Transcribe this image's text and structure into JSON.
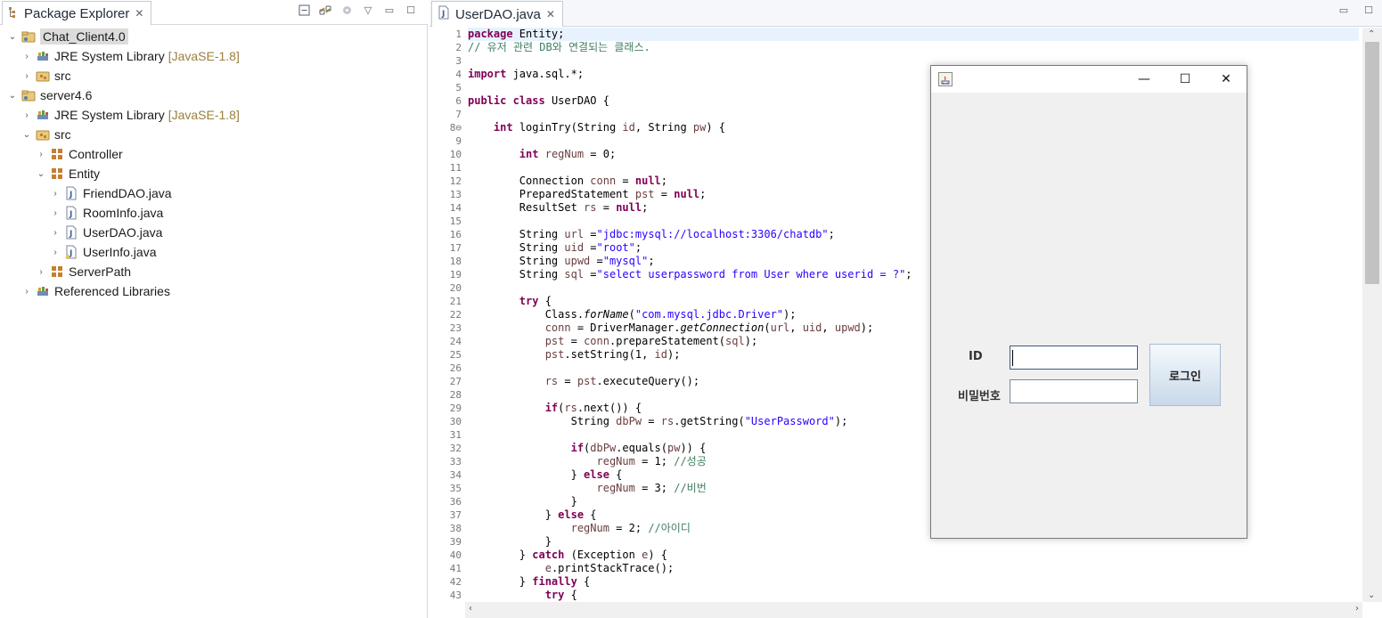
{
  "package_explorer": {
    "title": "Package Explorer",
    "tree": [
      {
        "label": "Chat_Client4.0",
        "decoration": "",
        "icon": "java-project-icon",
        "selected": true,
        "expanded": true
      },
      {
        "label": "JRE System Library",
        "decoration": "[JavaSE-1.8]",
        "icon": "library-icon",
        "expanded": false
      },
      {
        "label": "src",
        "decoration": "",
        "icon": "source-folder-icon",
        "expanded": false
      },
      {
        "label": "server4.6",
        "decoration": "",
        "icon": "java-project-icon",
        "expanded": true
      },
      {
        "label": "JRE System Library",
        "decoration": "[JavaSE-1.8]",
        "icon": "library-icon",
        "expanded": false
      },
      {
        "label": "src",
        "decoration": "",
        "icon": "source-folder-icon",
        "expanded": true
      },
      {
        "label": "Controller",
        "decoration": "",
        "icon": "package-icon",
        "expanded": false
      },
      {
        "label": "Entity",
        "decoration": "",
        "icon": "package-icon",
        "expanded": true
      },
      {
        "label": "FriendDAO.java",
        "decoration": "",
        "icon": "java-file-icon",
        "expanded": false
      },
      {
        "label": "RoomInfo.java",
        "decoration": "",
        "icon": "java-file-icon",
        "expanded": false
      },
      {
        "label": "UserDAO.java",
        "decoration": "",
        "icon": "java-file-icon",
        "expanded": false
      },
      {
        "label": "UserInfo.java",
        "decoration": "",
        "icon": "java-file-icon",
        "expanded": false
      },
      {
        "label": "ServerPath",
        "decoration": "",
        "icon": "package-icon",
        "expanded": false
      },
      {
        "label": "Referenced Libraries",
        "decoration": "",
        "icon": "library-icon",
        "expanded": false
      }
    ]
  },
  "editor": {
    "tab_title": "UserDAO.java",
    "lines": [
      "package Entity;",
      "// 유저 관련 DB와 연결되는 클래스.",
      "",
      "import java.sql.*;",
      "",
      "public class UserDAO {",
      "",
      "    int loginTry(String id, String pw) {",
      "",
      "        int regNum = 0;",
      "",
      "        Connection conn = null;",
      "        PreparedStatement pst = null;",
      "        ResultSet rs = null;",
      "",
      "        String url =\"jdbc:mysql://localhost:3306/chatdb\";",
      "        String uid =\"root\";",
      "        String upwd =\"mysql\";",
      "        String sql =\"select userpassword from User where userid = ?\";",
      "",
      "        try {",
      "            Class.forName(\"com.mysql.jdbc.Driver\");",
      "            conn = DriverManager.getConnection(url, uid, upwd);",
      "            pst = conn.prepareStatement(sql);",
      "            pst.setString(1, id);",
      "",
      "            rs = pst.executeQuery();",
      "",
      "            if(rs.next()) {",
      "                String dbPw = rs.getString(\"UserPassword\");",
      "",
      "                if(dbPw.equals(pw)) {",
      "                    regNum = 1; //성공",
      "                } else {",
      "                    regNum = 3; //비번",
      "                }",
      "            } else {",
      "                regNum = 2; //아이디",
      "            }",
      "        } catch (Exception e) {",
      "            e.printStackTrace();",
      "        } finally {",
      "            try {"
    ]
  },
  "login_dialog": {
    "id_label": "ID",
    "password_label": "비밀번호",
    "login_button": "로그인",
    "id_value": "",
    "password_value": ""
  },
  "colors": {
    "keyword": "#7f0055",
    "string": "#2a00ff",
    "comment": "#3f7f5f",
    "field": "#6a3e3e",
    "selection": "#dcdcdc"
  }
}
